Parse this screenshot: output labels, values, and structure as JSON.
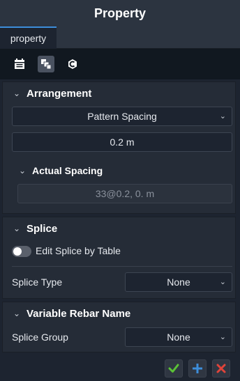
{
  "title": "Property",
  "tabs": [
    {
      "label": "property"
    }
  ],
  "toolbar": {
    "icons": [
      "calendar-icon",
      "layers-icon",
      "c-code-icon"
    ],
    "active_icon": "layers-icon"
  },
  "arrangement": {
    "title": "Arrangement",
    "method_value": "Pattern Spacing",
    "spacing_value": "0.2 m",
    "actual_spacing": {
      "title": "Actual Spacing",
      "value": "33@0.2, 0. m"
    }
  },
  "splice": {
    "title": "Splice",
    "edit_by_table_label": "Edit Splice by Table",
    "edit_by_table_on": false,
    "splice_type_label": "Splice Type",
    "splice_type_value": "None"
  },
  "variable_rebar_name": {
    "title": "Variable Rebar Name",
    "splice_group_label": "Splice Group",
    "splice_group_value": "None"
  },
  "footer": {
    "icons": [
      "check-icon",
      "plus-icon",
      "close-icon"
    ]
  },
  "colors": {
    "accent": "#3d8edb",
    "confirm": "#5bc236",
    "add": "#3d8edb",
    "cancel": "#e0443a"
  }
}
